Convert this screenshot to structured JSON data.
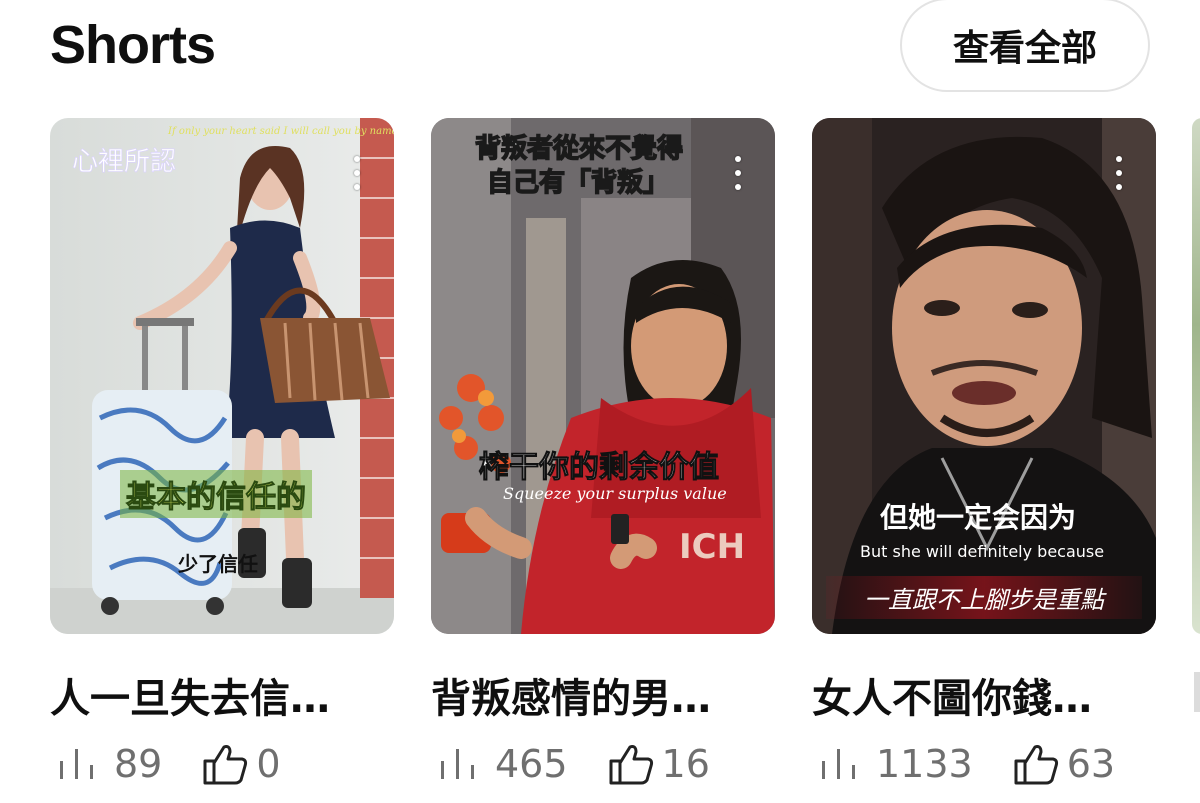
{
  "section": {
    "title": "Shorts",
    "view_all_label": "查看全部"
  },
  "shorts": [
    {
      "overlay_top": "心裡所認",
      "overlay_caption": "基本的信任的",
      "overlay_sub": "少了信任",
      "title": "人一旦失去信…",
      "views": "89",
      "likes": "0"
    },
    {
      "overlay_top_line1": "背叛者從來不覺得",
      "overlay_top_line2": "自己有「背叛」",
      "overlay_caption": "榨干你的剩余价值",
      "overlay_sub": "Squeeze your surplus value",
      "title": "背叛感情的男…",
      "views": "465",
      "likes": "16"
    },
    {
      "overlay_caption": "但她一定会因为",
      "overlay_sub": "But she will definitely because",
      "overlay_script": "一直跟不上腳步是重點",
      "title": "女人不圖你錢…",
      "views": "1133",
      "likes": "63"
    }
  ],
  "icons": {
    "views": "views-bar-icon",
    "likes": "thumbs-up-icon",
    "more": "more-vert-icon"
  }
}
